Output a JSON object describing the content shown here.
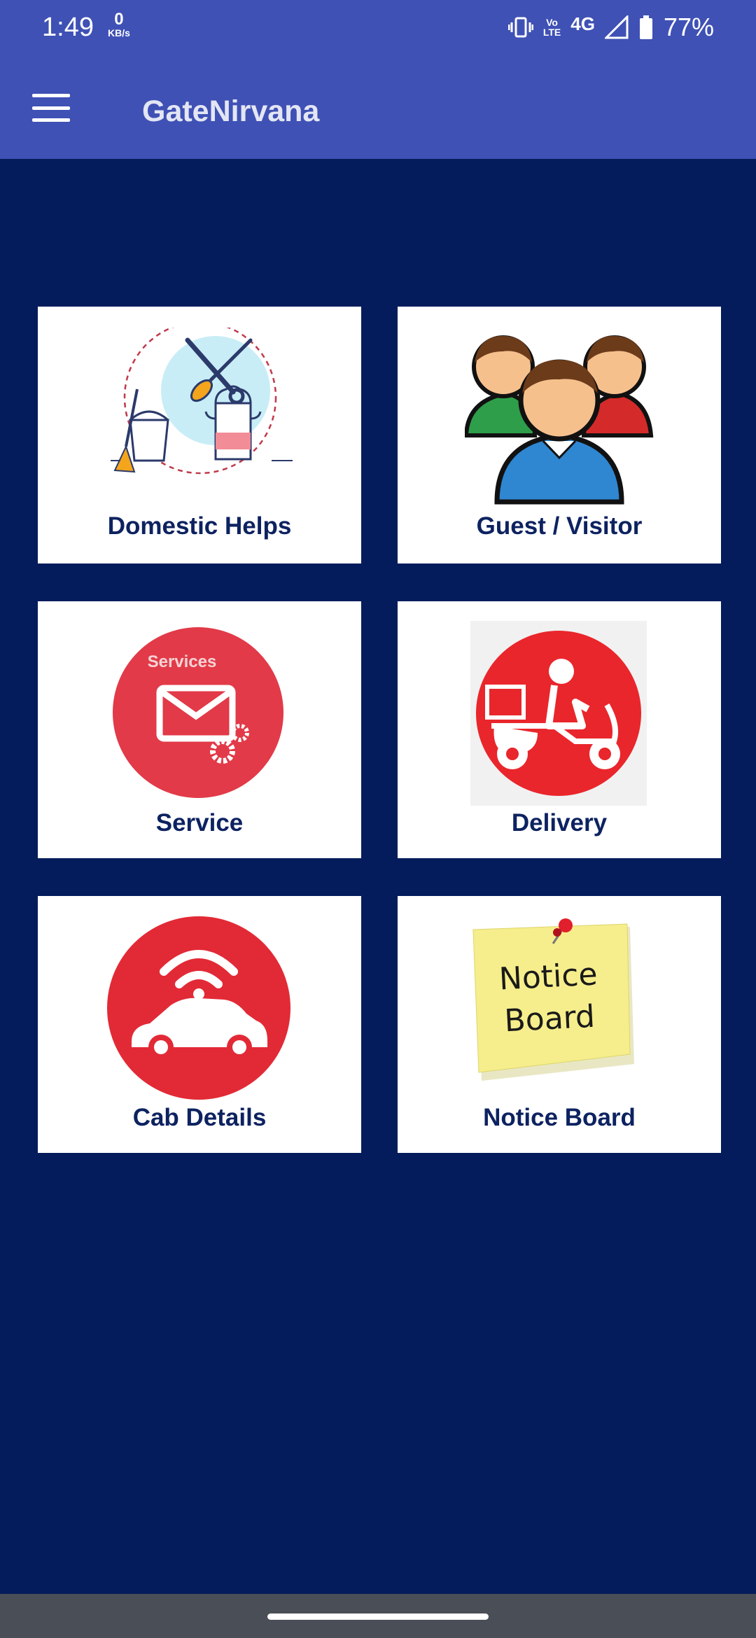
{
  "status_bar": {
    "time": "1:49",
    "net_speed_value": "0",
    "net_speed_unit": "KB/s",
    "volte_label_top": "Vo",
    "volte_label_bottom": "LTE",
    "network_type": "4G",
    "battery_percent": "77%"
  },
  "app_bar": {
    "title": "GateNirvana",
    "menu_icon": "hamburger-menu-icon"
  },
  "tiles": [
    {
      "label": "Domestic Helps",
      "icon": "domestic-helps-icon"
    },
    {
      "label": "Guest / Visitor",
      "icon": "guest-visitor-icon"
    },
    {
      "label": "Service",
      "icon": "service-icon",
      "icon_text": "Services"
    },
    {
      "label": "Delivery",
      "icon": "delivery-scooter-icon"
    },
    {
      "label": "Cab Details",
      "icon": "cab-car-icon"
    },
    {
      "label": "Notice Board",
      "icon": "notice-board-icon",
      "icon_text_line1": "Notice",
      "icon_text_line2": "Board"
    }
  ],
  "colors": {
    "app_bar": "#3f51b5",
    "background": "#041c5c",
    "label_text": "#0d2260",
    "accent_red": "#e63946"
  }
}
